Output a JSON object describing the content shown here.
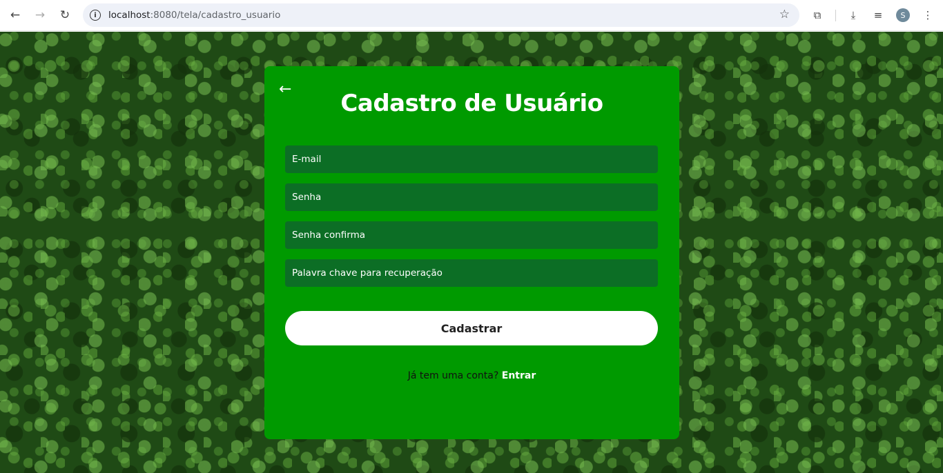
{
  "browser": {
    "url_host": "localhost",
    "url_rest": ":8080/tela/cadastro_usuario",
    "avatar_initial": "S"
  },
  "icons": {
    "back": "←",
    "forward": "→",
    "reload": "↻",
    "info": "i",
    "star": "☆",
    "extensions": "⧉",
    "download": "⤓",
    "media": "≡",
    "menu": "⋮",
    "form_back": "←"
  },
  "form": {
    "title": "Cadastro de Usuário",
    "fields": [
      {
        "placeholder": "E-mail"
      },
      {
        "placeholder": "Senha"
      },
      {
        "placeholder": "Senha confirma"
      },
      {
        "placeholder": "Palavra chave para recuperação"
      }
    ],
    "submit_label": "Cadastrar",
    "login_prompt": "Já tem uma conta?",
    "login_link": "Entrar"
  },
  "colors": {
    "card": "#009a00",
    "field": "#0c6e25",
    "button": "#ffffff"
  }
}
